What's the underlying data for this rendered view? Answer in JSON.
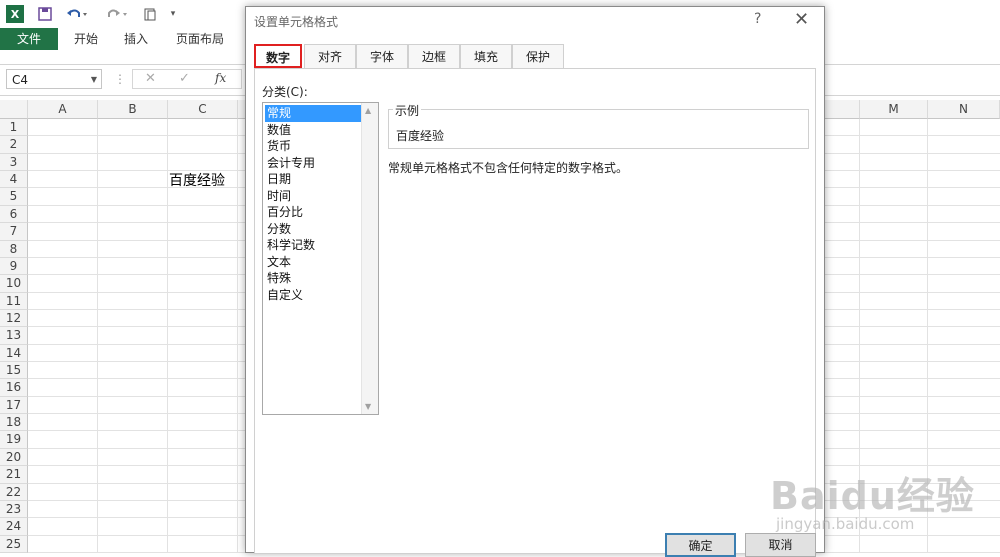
{
  "qat": {
    "logo": "X",
    "save_icon": "save-icon",
    "undo_icon": "undo-icon",
    "redo_icon": "redo-icon",
    "customize": "▾"
  },
  "ribbon": {
    "tabs": [
      {
        "label": "文件"
      },
      {
        "label": "开始"
      },
      {
        "label": "插入"
      },
      {
        "label": "页面布局"
      }
    ]
  },
  "formula_bar": {
    "name_box": "C4",
    "fx": "fx"
  },
  "grid": {
    "columns": [
      "A",
      "B",
      "C",
      "",
      "M",
      "N"
    ],
    "rows": [
      "1",
      "2",
      "3",
      "4",
      "5",
      "6",
      "7",
      "8",
      "9",
      "10",
      "11",
      "12",
      "13",
      "14",
      "15",
      "16",
      "17",
      "18",
      "19",
      "20",
      "21",
      "22",
      "23",
      "24",
      "25"
    ],
    "cell_c4": "百度经验"
  },
  "dialog": {
    "title": "设置单元格格式",
    "help": "?",
    "close": "✕",
    "tabs": [
      {
        "label": "数字"
      },
      {
        "label": "对齐"
      },
      {
        "label": "字体"
      },
      {
        "label": "边框"
      },
      {
        "label": "填充"
      },
      {
        "label": "保护"
      }
    ],
    "category_label": "分类(C):",
    "categories": [
      "常规",
      "数值",
      "货币",
      "会计专用",
      "日期",
      "时间",
      "百分比",
      "分数",
      "科学记数",
      "文本",
      "特殊",
      "自定义"
    ],
    "selected_category": "常规",
    "sample_label": "示例",
    "sample_value": "百度经验",
    "description": "常规单元格格式不包含任何特定的数字格式。",
    "ok": "确定",
    "cancel": "取消"
  },
  "watermark": {
    "logo": "Baidu经验",
    "url": "jingyan.baidu.com"
  },
  "colors": {
    "excel_green": "#217346",
    "highlight_red": "#e02020",
    "selection_blue": "#3399ff"
  }
}
